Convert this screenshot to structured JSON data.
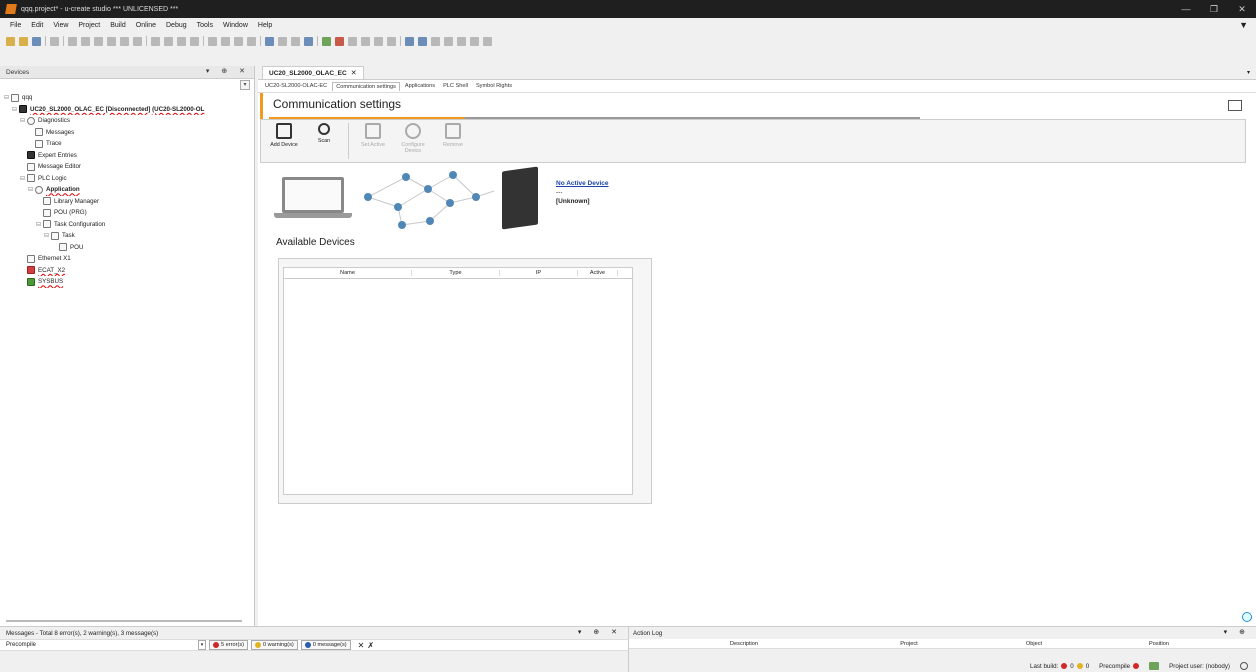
{
  "window": {
    "title": "qqq.project* - u-create studio *** UNLICENSED ***"
  },
  "menu": [
    "File",
    "Edit",
    "View",
    "Project",
    "Build",
    "Online",
    "Debug",
    "Tools",
    "Window",
    "Help"
  ],
  "devices_panel": {
    "title": "Devices",
    "tree": [
      {
        "label": "qqq",
        "level": 0,
        "icon": "project-icon"
      },
      {
        "label": "UC20_SL2000_OLAC_EC [Disconnected] (UC20-SL2000-OL",
        "level": 1,
        "icon": "plc-device-icon"
      },
      {
        "label": "Diagnostics",
        "level": 2,
        "icon": "diagnostics-icon"
      },
      {
        "label": "Messages",
        "level": 3,
        "icon": "messages-icon"
      },
      {
        "label": "Trace",
        "level": 3,
        "icon": "trace-icon"
      },
      {
        "label": "Expert Entries",
        "level": 2,
        "icon": "expert-icon"
      },
      {
        "label": "Message Editor",
        "level": 2,
        "icon": "message-editor-icon"
      },
      {
        "label": "PLC Logic",
        "level": 2,
        "icon": "plc-logic-icon"
      },
      {
        "label": "Application",
        "level": 3,
        "icon": "application-icon"
      },
      {
        "label": "Library Manager",
        "level": 4,
        "icon": "library-icon"
      },
      {
        "label": "POU (PRG)",
        "level": 4,
        "icon": "pou-icon"
      },
      {
        "label": "Task Configuration",
        "level": 4,
        "icon": "task-config-icon"
      },
      {
        "label": "Task",
        "level": 5,
        "icon": "task-icon"
      },
      {
        "label": "POU",
        "level": 6,
        "icon": "pou-call-icon"
      },
      {
        "label": "Ethernet X1",
        "level": 2,
        "icon": "ethernet-icon"
      },
      {
        "label": "ECAT_X2",
        "level": 2,
        "icon": "ecat-icon"
      },
      {
        "label": "SYSBUS",
        "level": 2,
        "icon": "sysbus-icon"
      }
    ]
  },
  "editor": {
    "doc_tab": "UC20_SL2000_OLAC_EC",
    "subtabs": [
      "UC20-SL2000-OLAC-EC",
      "Communication settings",
      "Applications",
      "PLC Shell",
      "Symbol Rights"
    ],
    "heading": "Communication settings",
    "actions": [
      {
        "label": "Add Device",
        "enabled": true
      },
      {
        "label": "Scan",
        "enabled": true
      },
      {
        "label": "Set Active",
        "enabled": false
      },
      {
        "label": "Configure Device",
        "enabled": false
      },
      {
        "label": "Remove",
        "enabled": false
      }
    ],
    "device_status": {
      "name": "No Active Device",
      "sub": "---",
      "state": "[Unknown]"
    },
    "available_title": "Available Devices",
    "table_columns": [
      "Name",
      "Type",
      "IP",
      "Active"
    ]
  },
  "messages": {
    "title": "Messages - Total 8 error(s), 2 warning(s), 3 message(s)",
    "filter_value": "Precompile",
    "errors": "5 error(s)",
    "warnings": "0 warning(s)",
    "infos": "0 message(s)"
  },
  "action_log": {
    "title": "Action Log",
    "columns": [
      "Description",
      "Project",
      "Object",
      "Position"
    ]
  },
  "status": {
    "last_build_label": "Last build:",
    "last_build_errors": "0",
    "last_build_warnings": "0",
    "precompile": "Precompile",
    "project_user": "Project user: (nobody)"
  }
}
